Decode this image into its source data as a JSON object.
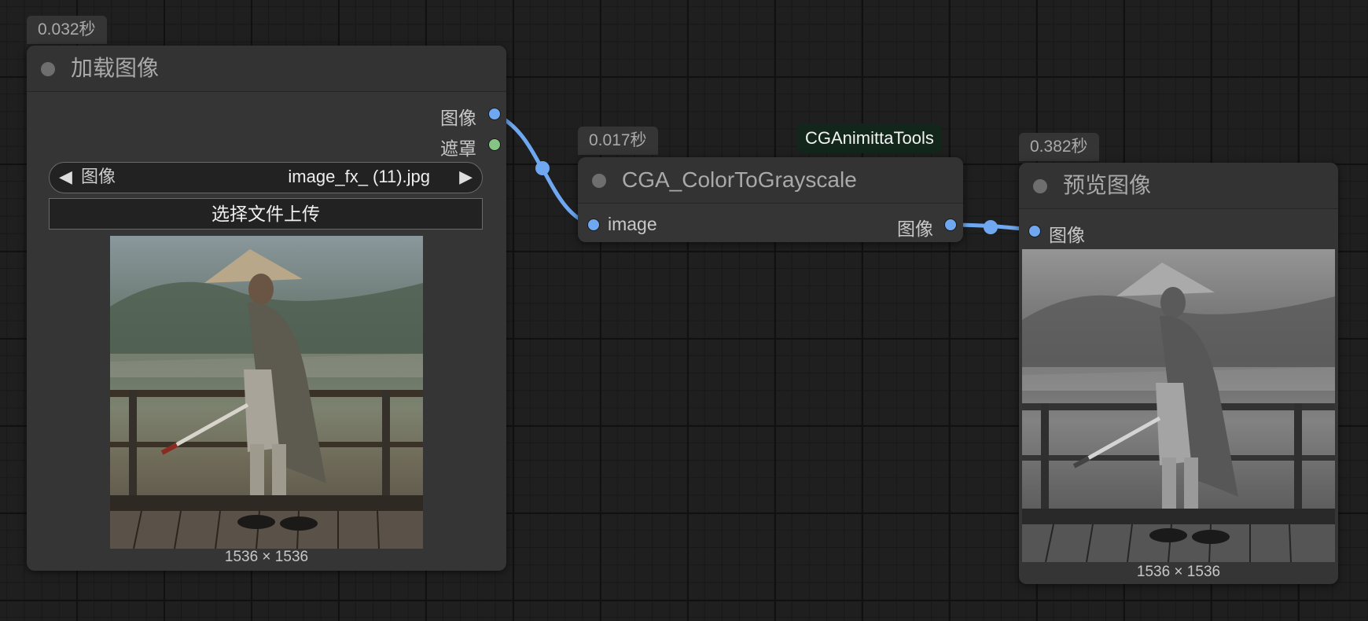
{
  "load_node": {
    "time_badge": "0.032秒",
    "title": "加载图像",
    "outputs": {
      "image": "图像",
      "mask": "遮罩"
    },
    "image_selector": {
      "label": "图像",
      "value": "image_fx_ (11).jpg",
      "prev_glyph": "◀",
      "next_glyph": "▶"
    },
    "upload_label": "选择文件上传",
    "image_dims": "1536 × 1536"
  },
  "grayscale_node": {
    "time_badge": "0.017秒",
    "group_tag": "CGAnimittaTools",
    "title": "CGA_ColorToGrayscale",
    "input_label": "image",
    "output_label": "图像"
  },
  "preview_node": {
    "time_badge": "0.382秒",
    "title": "预览图像",
    "input_label": "图像",
    "image_dims": "1536 × 1536"
  },
  "colors": {
    "canvas_bg": "#1f1f1f",
    "node_bg": "#353535",
    "image_link": "#6fa8f0",
    "image_slot": "#6fa8f0",
    "mask_slot": "#86c486",
    "group_tag_bg": "#13261b"
  }
}
